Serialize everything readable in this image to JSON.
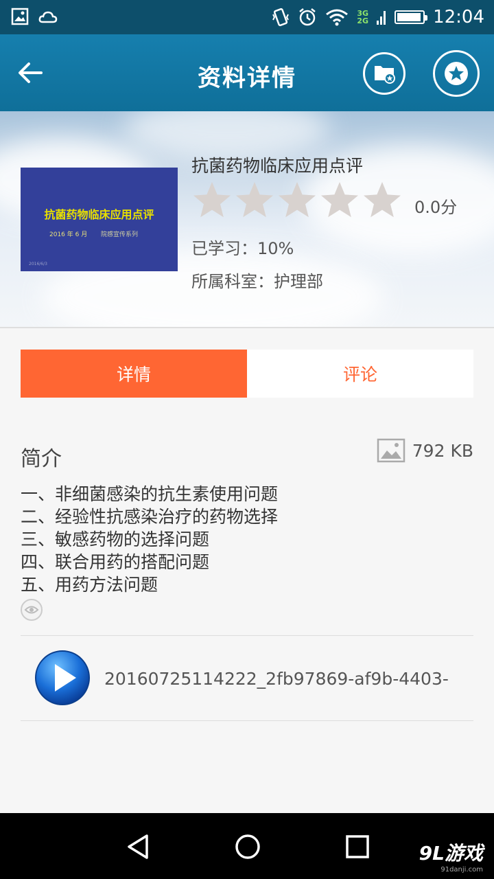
{
  "status_bar": {
    "time": "12:04",
    "network_top": "3G",
    "network_bottom": "2G",
    "icons": [
      "image-icon",
      "weather-icon",
      "vibrate-icon",
      "alarm-icon",
      "wifi-icon",
      "signal-icon",
      "battery-icon"
    ]
  },
  "toolbar": {
    "title": "资料详情",
    "back_icon": "back-arrow-icon",
    "folder_icon": "folder-star-icon",
    "favorite_icon": "star-icon"
  },
  "material": {
    "title": "抗菌药物临床应用点评",
    "thumbnail": {
      "title": "抗菌药物临床应用点评",
      "date": "2016 年 6 月",
      "series": "院感宣传系列",
      "footer": "2016/6/3"
    },
    "rating": {
      "score": 0.0,
      "max": 5,
      "score_label": "0.0分"
    },
    "learned_label": "已学习：",
    "learned_value": "10%",
    "dept_label": "所属科室：",
    "dept_value": "护理部"
  },
  "tabs": [
    {
      "label": "详情",
      "active": true
    },
    {
      "label": "评论",
      "active": false
    }
  ],
  "intro": {
    "label": "简介",
    "file_size": "792 KB",
    "lines": [
      "一、非细菌感染的抗生素使用问题",
      "二、经验性抗感染治疗的药物选择",
      "三、敏感药物的选择问题",
      "四、联合用药的搭配问题",
      "五、用药方法问题"
    ]
  },
  "attachment": {
    "filename": "20160725114222_2fb97869-af9b-4403-"
  },
  "colors": {
    "toolbar": "#1379a3",
    "accent": "#ff6633",
    "thumbnail_bg": "#33409a"
  },
  "watermark": {
    "brand": "9L游戏",
    "url": "91danji.com"
  }
}
